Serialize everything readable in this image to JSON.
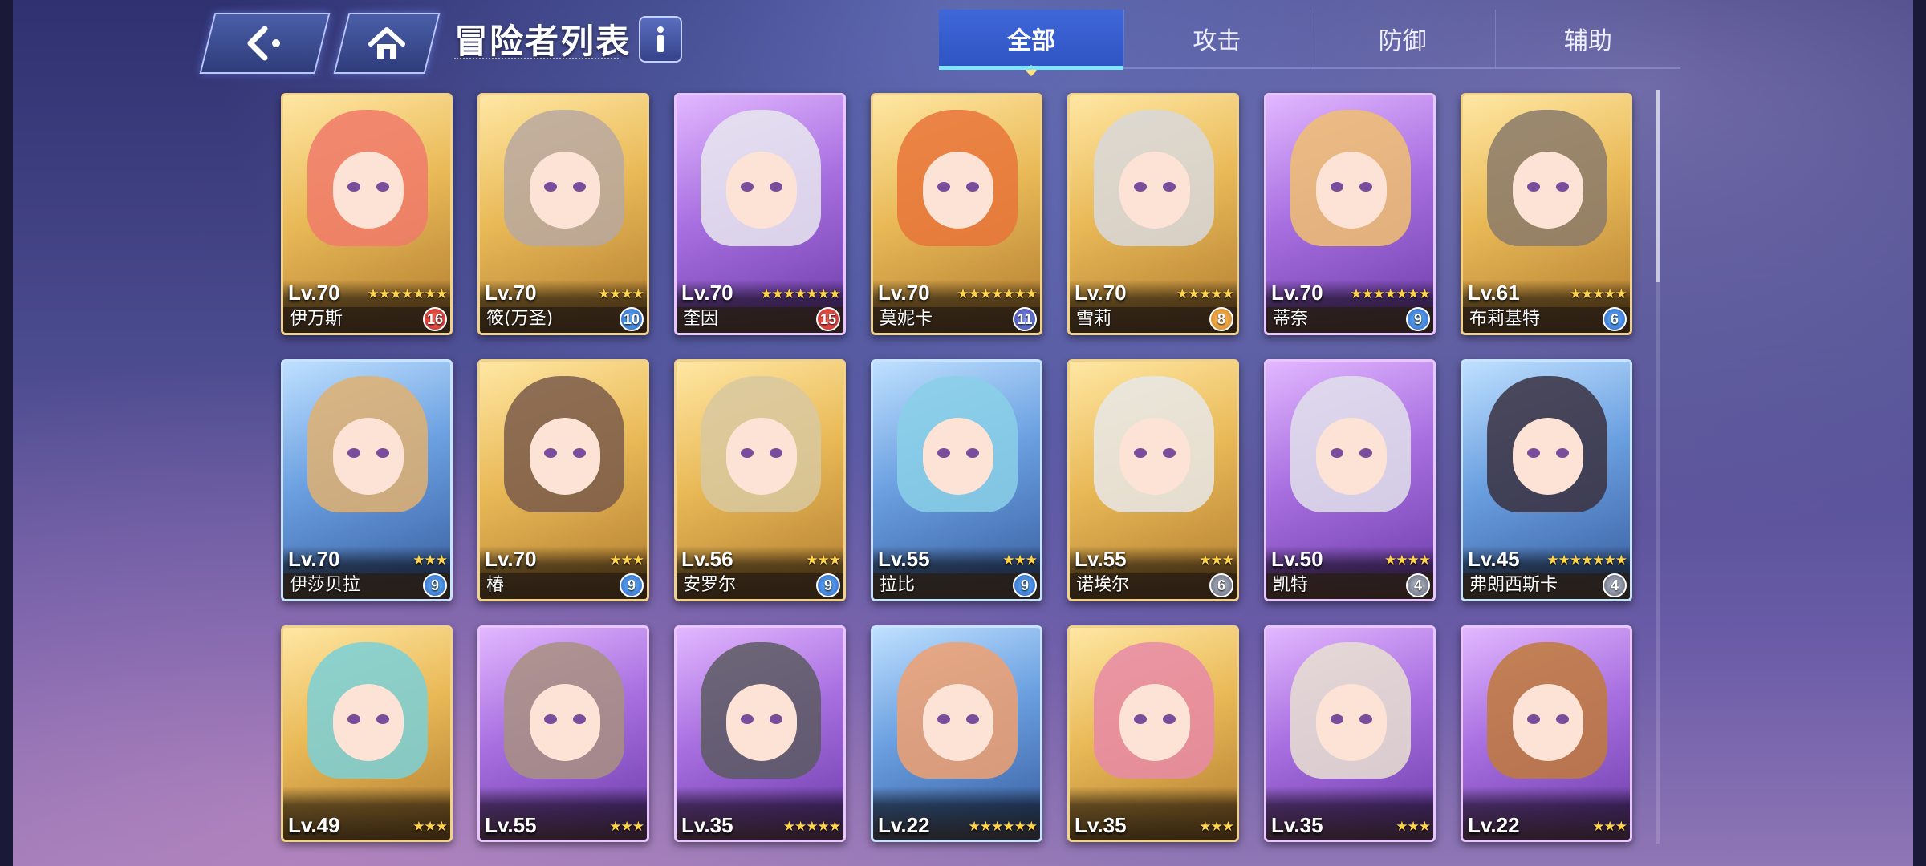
{
  "header": {
    "title": "冒险者列表",
    "back_icon": "back-arrow-icon",
    "home_icon": "home-icon",
    "info_icon": "info-icon"
  },
  "tabs": [
    {
      "label": "全部",
      "active": true
    },
    {
      "label": "攻击",
      "active": false
    },
    {
      "label": "防御",
      "active": false
    },
    {
      "label": "辅助",
      "active": false
    }
  ],
  "colors": {
    "accent": "#2f54c4",
    "tab_highlight": "#7ee7ff",
    "star": "#ffd34a"
  },
  "cards": [
    {
      "level": "Lv.70",
      "name": "伊万斯",
      "badge": "16",
      "stars": 7,
      "frame": "gold",
      "badge_color": "red",
      "hair": "#f07a6a"
    },
    {
      "level": "Lv.70",
      "name": "筱(万圣)",
      "badge": "10",
      "stars": 4,
      "frame": "gold",
      "badge_color": "blue",
      "hair": "#b8a8a0"
    },
    {
      "level": "Lv.70",
      "name": "奎因",
      "badge": "15",
      "stars": 7,
      "frame": "purple",
      "badge_color": "red",
      "hair": "#e8e8ee"
    },
    {
      "level": "Lv.70",
      "name": "莫妮卡",
      "badge": "11",
      "stars": 7,
      "frame": "gold",
      "badge_color": "navy",
      "hair": "#e8743a"
    },
    {
      "level": "Lv.70",
      "name": "雪莉",
      "badge": "8",
      "stars": 5,
      "frame": "gold",
      "badge_color": "orange",
      "hair": "#d8d8dc"
    },
    {
      "level": "Lv.70",
      "name": "蒂奈",
      "badge": "9",
      "stars": 7,
      "frame": "purple",
      "badge_color": "blue",
      "hair": "#f0c070"
    },
    {
      "level": "Lv.61",
      "name": "布莉基特",
      "badge": "6",
      "stars": 5,
      "frame": "gold",
      "badge_color": "blue",
      "hair": "#8a7a6a"
    },
    {
      "level": "Lv.70",
      "name": "伊莎贝拉",
      "badge": "9",
      "stars": 3,
      "frame": "blue",
      "badge_color": "blue",
      "hair": "#e0b070"
    },
    {
      "level": "Lv.70",
      "name": "椿",
      "badge": "9",
      "stars": 3,
      "frame": "gold",
      "badge_color": "blue",
      "hair": "#7a5a4a"
    },
    {
      "level": "Lv.56",
      "name": "安罗尔",
      "badge": "9",
      "stars": 3,
      "frame": "gold",
      "badge_color": "blue",
      "hair": "#d8c8a0"
    },
    {
      "level": "Lv.55",
      "name": "拉比",
      "badge": "9",
      "stars": 3,
      "frame": "blue",
      "badge_color": "blue",
      "hair": "#8ad0e8"
    },
    {
      "level": "Lv.55",
      "name": "诺埃尔",
      "badge": "6",
      "stars": 3,
      "frame": "gold",
      "badge_color": "grey",
      "hair": "#e8e8e8"
    },
    {
      "level": "Lv.50",
      "name": "凯特",
      "badge": "4",
      "stars": 4,
      "frame": "purple",
      "badge_color": "grey",
      "hair": "#e0e0ea"
    },
    {
      "level": "Lv.45",
      "name": "弗朗西斯卡",
      "badge": "4",
      "stars": 7,
      "frame": "blue",
      "badge_color": "grey",
      "hair": "#3a3040"
    },
    {
      "level": "Lv.49",
      "name": "",
      "badge": "",
      "stars": 3,
      "frame": "gold",
      "badge_color": "",
      "hair": "#7ad0d8"
    },
    {
      "level": "Lv.55",
      "name": "",
      "badge": "",
      "stars": 3,
      "frame": "purple",
      "badge_color": "",
      "hair": "#a89080"
    },
    {
      "level": "Lv.35",
      "name": "",
      "badge": "",
      "stars": 5,
      "frame": "purple",
      "badge_color": "",
      "hair": "#5a5a60"
    },
    {
      "level": "Lv.22",
      "name": "",
      "badge": "",
      "stars": 6,
      "frame": "blue",
      "badge_color": "",
      "hair": "#f0a070"
    },
    {
      "level": "Lv.35",
      "name": "",
      "badge": "",
      "stars": 3,
      "frame": "gold",
      "badge_color": "",
      "hair": "#e88aa8"
    },
    {
      "level": "Lv.35",
      "name": "",
      "badge": "",
      "stars": 3,
      "frame": "purple",
      "badge_color": "",
      "hair": "#e8e0d0"
    },
    {
      "level": "Lv.22",
      "name": "",
      "badge": "",
      "stars": 3,
      "frame": "purple",
      "badge_color": "",
      "hair": "#c07a3a"
    }
  ]
}
